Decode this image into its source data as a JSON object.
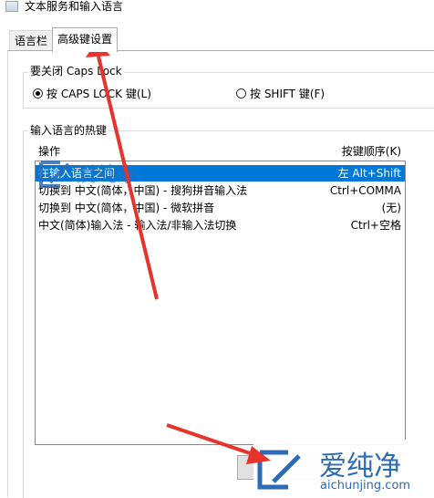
{
  "window": {
    "title": "文本服务和输入语言"
  },
  "tabs": [
    {
      "label": "语言栏",
      "active": false
    },
    {
      "label": "高级键设置",
      "active": true
    }
  ],
  "caps_lock": {
    "legend": "要关闭 Caps Lock",
    "options": [
      {
        "label": "按 CAPS LOCK 键(L)",
        "checked": true
      },
      {
        "label": "按 SHIFT 键(F)",
        "checked": false
      }
    ]
  },
  "hotkeys": {
    "legend": "输入语言的热键",
    "col_action": "操作",
    "col_key": "按键顺序(K)",
    "rows": [
      {
        "action": "在输入语言之间",
        "key": "左 Alt+Shift",
        "selected": true
      },
      {
        "action": "切换到 中文(简体，中国) - 搜狗拼音输入法",
        "key": "Ctrl+COMMA",
        "selected": false
      },
      {
        "action": "切换到 中文(简体，中国) - 微软拼音",
        "key": "(无)",
        "selected": false
      },
      {
        "action": "中文(简体)输入法 - 输入法/非输入法切换",
        "key": "Ctrl+空格",
        "selected": false
      }
    ]
  },
  "watermark": {
    "brand": "爱纯净",
    "url": "aichunjing.com",
    "color": "#2d6bb4"
  },
  "annotation": {
    "arrow_color": "#e8322c"
  }
}
